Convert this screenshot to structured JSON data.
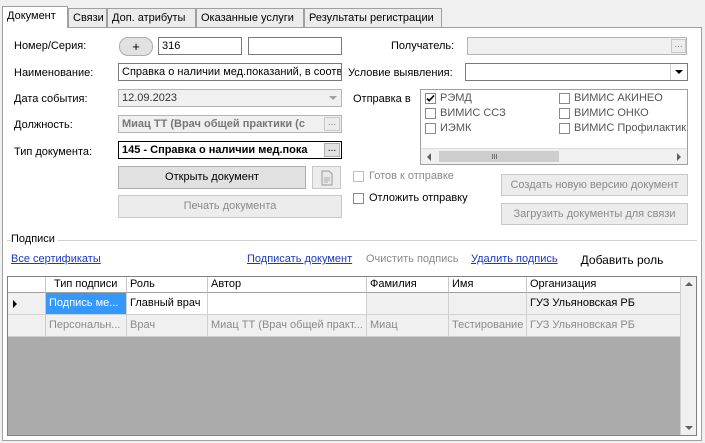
{
  "tabs": [
    "Документ",
    "Связи",
    "Доп. атрибуты",
    "Оказанные услуги",
    "Результаты регистрации"
  ],
  "form": {
    "number_label": "Номер/Серия:",
    "add_btn": "+",
    "number_value": "316",
    "series_value": "",
    "name_label": "Наименование:",
    "name_value": "Справка о наличии мед.показаний, в соотв",
    "date_label": "Дата события:",
    "date_value": "12.09.2023",
    "position_label": "Должность:",
    "position_value": "Миац ТТ (Врач общей практики (с",
    "position_btn": "...",
    "doctype_label": "Тип документа:",
    "doctype_value": "145 - Справка о наличии мед.пока",
    "doctype_btn": "...",
    "open_doc_btn": "Открыть документ",
    "print_doc_btn": "Печать документа",
    "recipient_label": "Получатель:",
    "recipient_btn": "...",
    "condition_label": "Условие выявления:",
    "send_label": "Отправка в",
    "ready_label": "Готов к отправке",
    "postpone_label": "Отложить отправку",
    "new_version_btn": "Создать новую версию документ",
    "load_docs_btn": "Загрузить документы для связи"
  },
  "send_targets": [
    {
      "label": "РЭМД",
      "checked": true
    },
    {
      "label": "ВИМИС АКИНЕО",
      "checked": false
    },
    {
      "label": "ВИМИС ССЗ",
      "checked": false
    },
    {
      "label": "ВИМИС ОНКО",
      "checked": false
    },
    {
      "label": "ИЭМК",
      "checked": false
    },
    {
      "label": "ВИМИС Профилактика",
      "checked": false
    }
  ],
  "signatures": {
    "group_label": "Подписи",
    "all_certs": "Все сертификаты",
    "sign_doc": "Подписать документ",
    "clear_sign": "Очистить подпись",
    "delete_sign": "Удалить подпись",
    "add_role": "Добавить роль",
    "columns": [
      "Тип подписи",
      "Роль",
      "Автор",
      "Фамилия",
      "Имя",
      "Организация"
    ],
    "rows": [
      [
        "Подпись ме...",
        "Главный врач",
        "",
        "",
        "",
        "ГУЗ Ульяновская РБ"
      ],
      [
        "Персональн...",
        "Врач",
        "Миац ТТ (Врач общей практ...",
        "Миац",
        "Тестирование",
        "ГУЗ Ульяновская РБ"
      ]
    ]
  },
  "colors": {
    "selection": "#3399ff",
    "link": "#1a38c8"
  }
}
